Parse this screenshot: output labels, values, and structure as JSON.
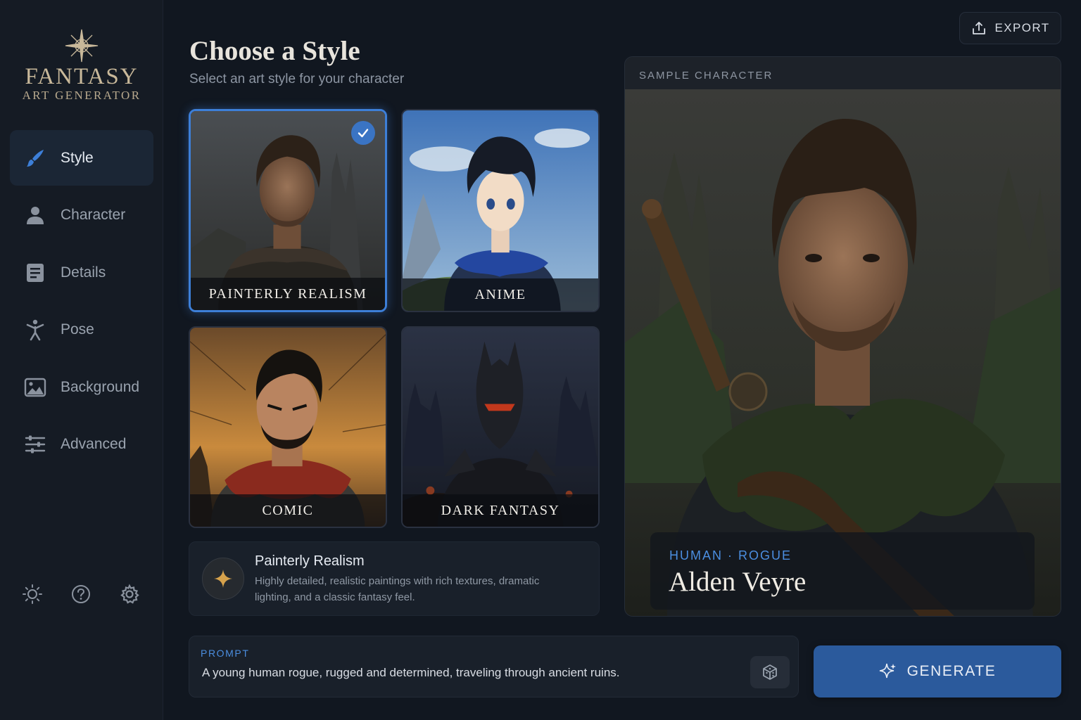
{
  "brand": {
    "title": "FANTASY",
    "subtitle": "ART GENERATOR"
  },
  "sidebar": {
    "items": [
      {
        "label": "Style",
        "icon": "brush-icon",
        "active": true
      },
      {
        "label": "Character",
        "icon": "person-icon",
        "active": false
      },
      {
        "label": "Details",
        "icon": "document-icon",
        "active": false
      },
      {
        "label": "Pose",
        "icon": "pose-figure-icon",
        "active": false
      },
      {
        "label": "Background",
        "icon": "image-icon",
        "active": false
      },
      {
        "label": "Advanced",
        "icon": "sliders-icon",
        "active": false
      }
    ],
    "footer_icons": [
      "sun-icon",
      "help-icon",
      "gear-icon"
    ]
  },
  "header": {
    "title": "Choose a Style",
    "subtitle": "Select an art style for your character"
  },
  "styles": [
    {
      "label": "PAINTERLY REALISM",
      "selected": true
    },
    {
      "label": "ANIME",
      "selected": false
    },
    {
      "label": "COMIC",
      "selected": false
    },
    {
      "label": "DARK FANTASY",
      "selected": false
    }
  ],
  "selected_style": {
    "name": "Painterly Realism",
    "description": "Highly detailed, realistic paintings with rich textures, dramatic lighting, and a classic fantasy feel.",
    "icon": "sparkle-icon"
  },
  "export": {
    "label": "EXPORT",
    "icon": "upload-icon"
  },
  "sample": {
    "heading": "SAMPLE CHARACTER",
    "tags": "HUMAN · ROGUE",
    "name": "Alden Veyre"
  },
  "prompt": {
    "label": "PROMPT",
    "value": "A young human rogue, rugged and determined, traveling through ancient ruins.",
    "dice_icon": "dice-icon"
  },
  "generate": {
    "label": "GENERATE",
    "icon": "sparkle-icon"
  },
  "colors": {
    "accent": "#3d7fd8",
    "generate_bg": "#2b5a9c",
    "tag_blue": "#4b8ee0",
    "brand_gold": "#c8b89a"
  }
}
